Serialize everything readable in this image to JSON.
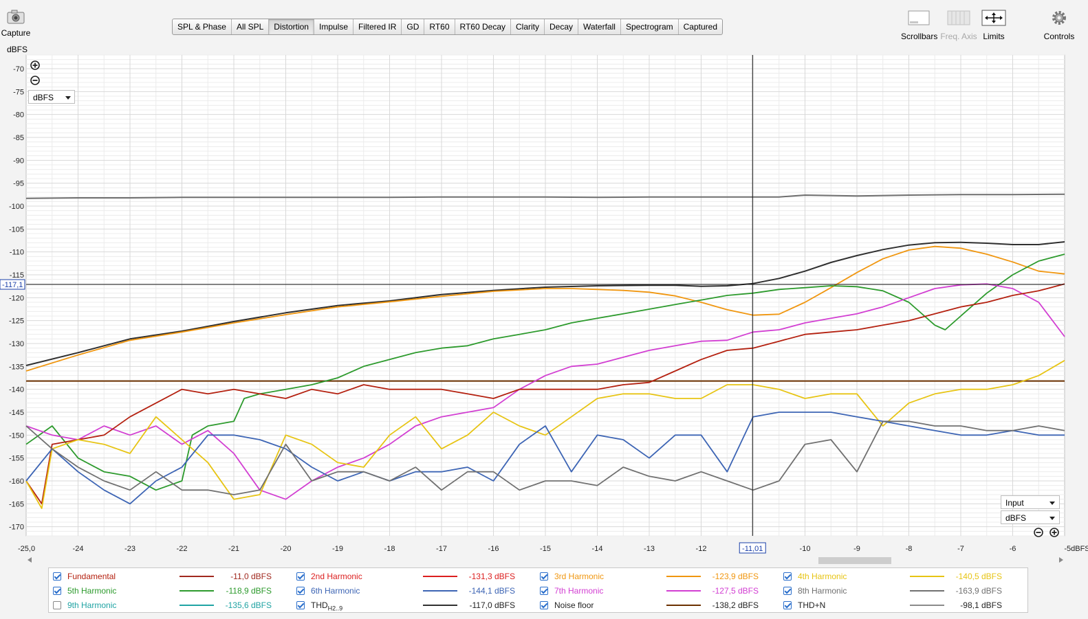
{
  "toolbar": {
    "capture_label": "Capture",
    "tabs": [
      "SPL & Phase",
      "All SPL",
      "Distortion",
      "Impulse",
      "Filtered IR",
      "GD",
      "RT60",
      "RT60 Decay",
      "Clarity",
      "Decay",
      "Waterfall",
      "Spectrogram",
      "Captured"
    ],
    "active_tab": "Distortion",
    "scrollbars_label": "Scrollbars",
    "freq_axis_label": "Freq. Axis",
    "limits_label": "Limits",
    "controls_label": "Controls"
  },
  "y_unit_label": "dBFS",
  "unit_dropdown": "dBFS",
  "input_dropdown": "Input",
  "scale_dropdown": "dBFS",
  "cursor": {
    "x": -11.01,
    "y": -117.1,
    "x_label": "-11,01",
    "y_label": "-117,1"
  },
  "chart_data": {
    "type": "line",
    "xlim": [
      -25,
      -5
    ],
    "ylim": [
      -172,
      -67
    ],
    "x_ticks": [
      -24,
      -23,
      -22,
      -21,
      -20,
      -19,
      -18,
      -17,
      -16,
      -15,
      -14,
      -13,
      -12,
      -11,
      -10,
      -9,
      -8,
      -7,
      -6
    ],
    "x_tick_labels": [
      "-24",
      "-23",
      "-22",
      "-21",
      "-20",
      "-19",
      "-18",
      "-17",
      "-16",
      "-15",
      "-14",
      "-13",
      "-12",
      "-11",
      "-10",
      "-9",
      "-8",
      "-7",
      "-6"
    ],
    "x_min_label": "-25,0",
    "x_max_label": "-5dBFS",
    "y_ticks": [
      -70,
      -75,
      -80,
      -85,
      -90,
      -95,
      -100,
      -105,
      -110,
      -115,
      -120,
      -125,
      -130,
      -135,
      -140,
      -145,
      -150,
      -155,
      -160,
      -165,
      -170
    ],
    "y_tick_labels": [
      "-70",
      "-75",
      "-80",
      "-85",
      "-90",
      "-95",
      "-100",
      "-105",
      "-110",
      "-115",
      "-120",
      "-125",
      "-130",
      "-135",
      "-140",
      "-145",
      "-150",
      "-155",
      "-160",
      "-165",
      "-170"
    ],
    "grid": true,
    "series": [
      {
        "name": "THD+N",
        "color": "#6e6e6e",
        "x": [
          -25,
          -24,
          -23,
          -22,
          -21,
          -20,
          -19,
          -18,
          -17,
          -16,
          -15,
          -14,
          -13,
          -12,
          -11,
          -10.5,
          -10,
          -9,
          -8,
          -7,
          -6,
          -5
        ],
        "y": [
          -98.3,
          -98.2,
          -98.2,
          -98.1,
          -98.1,
          -98.1,
          -98.1,
          -98.1,
          -98.0,
          -98.0,
          -98.0,
          -98.1,
          -98.0,
          -98.0,
          -98.0,
          -98.0,
          -97.6,
          -97.8,
          -97.6,
          -97.5,
          -97.5,
          -97.4
        ]
      },
      {
        "name": "THD<sub>H2..9</sub>",
        "color": "#2f2f2f",
        "x": [
          -25,
          -24,
          -23,
          -22,
          -21,
          -20,
          -19,
          -18,
          -17,
          -16,
          -15,
          -14,
          -13,
          -12.5,
          -12,
          -11.5,
          -11,
          -10.5,
          -10,
          -9.5,
          -9,
          -8.5,
          -8,
          -7.5,
          -7,
          -6.5,
          -6,
          -5.5,
          -5
        ],
        "y": [
          -134.8,
          -132.0,
          -129.0,
          -127.3,
          -125.2,
          -123.3,
          -121.7,
          -120.7,
          -119.3,
          -118.4,
          -117.7,
          -117.4,
          -117.3,
          -117.3,
          -117.5,
          -117.4,
          -116.9,
          -115.8,
          -114.2,
          -112.3,
          -110.8,
          -109.5,
          -108.5,
          -108.0,
          -107.9,
          -108.1,
          -108.4,
          -108.4,
          -107.8
        ]
      },
      {
        "name": "3rd Harmonic",
        "color": "#f0960f",
        "x": [
          -25,
          -24,
          -23,
          -22,
          -21,
          -20,
          -19,
          -18,
          -17,
          -16,
          -15,
          -14.5,
          -14,
          -13.5,
          -13,
          -12.5,
          -12,
          -11.5,
          -11,
          -10.5,
          -10,
          -9.5,
          -9,
          -8.5,
          -8,
          -7.5,
          -7,
          -6.5,
          -6,
          -5.5,
          -5
        ],
        "y": [
          -136.0,
          -132.5,
          -129.3,
          -127.5,
          -125.5,
          -123.7,
          -122.0,
          -120.9,
          -119.7,
          -118.6,
          -118.0,
          -118.0,
          -118.2,
          -118.4,
          -118.8,
          -119.6,
          -121.0,
          -122.6,
          -123.8,
          -123.6,
          -121.0,
          -117.8,
          -114.5,
          -111.5,
          -109.6,
          -108.8,
          -109.2,
          -110.5,
          -112.2,
          -114.2,
          -114.8
        ]
      },
      {
        "name": "5th Harmonic",
        "color": "#2c9a2c",
        "x": [
          -25,
          -24.5,
          -24,
          -23.5,
          -23,
          -22.5,
          -22,
          -21.8,
          -21.5,
          -21,
          -20.8,
          -20.5,
          -20,
          -19.5,
          -19,
          -18.5,
          -18,
          -17.5,
          -17,
          -16.5,
          -16,
          -15.5,
          -15,
          -14.5,
          -14,
          -13.5,
          -13,
          -12.5,
          -12,
          -11.5,
          -11,
          -10.5,
          -10,
          -9.5,
          -9,
          -8.5,
          -8,
          -7.5,
          -7.3,
          -7,
          -6.5,
          -6,
          -5.5,
          -5
        ],
        "y": [
          -152,
          -148,
          -155,
          -158,
          -159,
          -162,
          -160,
          -150,
          -148,
          -147,
          -142,
          -141,
          -140,
          -139,
          -137.5,
          -135,
          -133.5,
          -132,
          -131,
          -130.5,
          -129,
          -128,
          -127,
          -125.5,
          -124.5,
          -123.5,
          -122.5,
          -121.5,
          -120.5,
          -119.5,
          -119,
          -118.2,
          -117.8,
          -117.4,
          -117.6,
          -118.5,
          -121,
          -126,
          -127,
          -124,
          -119,
          -115,
          -112,
          -110.5
        ]
      },
      {
        "name": "7th Harmonic",
        "color": "#d23ed2",
        "x": [
          -25,
          -24.5,
          -24,
          -23.5,
          -23,
          -22.5,
          -22,
          -21.5,
          -21,
          -20.5,
          -20,
          -19.5,
          -19,
          -18.5,
          -18,
          -17.5,
          -17,
          -16.5,
          -16,
          -15.5,
          -15,
          -14.5,
          -14,
          -13.5,
          -13,
          -12.5,
          -12,
          -11.5,
          -11,
          -10.5,
          -10,
          -9.5,
          -9,
          -8.5,
          -8,
          -7.5,
          -7,
          -6.5,
          -6,
          -5.5,
          -5
        ],
        "y": [
          -148,
          -150,
          -151,
          -148,
          -150,
          -148,
          -152,
          -149,
          -154,
          -162,
          -164,
          -160,
          -157,
          -155,
          -152,
          -148,
          -146,
          -145,
          -144,
          -140,
          -137,
          -135,
          -134.5,
          -133,
          -131.5,
          -130.5,
          -129.5,
          -129.3,
          -127.5,
          -127,
          -125.5,
          -124.5,
          -123.5,
          -122,
          -120,
          -118,
          -117.2,
          -117,
          -118,
          -121,
          -128.5
        ]
      },
      {
        "name": "Fundamental",
        "color": "#b4200f",
        "x": [
          -25,
          -24.7,
          -24.5,
          -24,
          -23.5,
          -23,
          -22.5,
          -22,
          -21.5,
          -21,
          -20.5,
          -20,
          -19.5,
          -19,
          -18.5,
          -18,
          -17.5,
          -17,
          -16.5,
          -16,
          -15.5,
          -15,
          -14.5,
          -14,
          -13.5,
          -13,
          -12.5,
          -12,
          -11.5,
          -11,
          -10.5,
          -10,
          -9.5,
          -9,
          -8.5,
          -8,
          -7.5,
          -7,
          -6.5,
          -6,
          -5.5,
          -5
        ],
        "y": [
          -160,
          -165,
          -152,
          -151,
          -150,
          -146,
          -143,
          -140,
          -141,
          -140,
          -141,
          -142,
          -140,
          -141,
          -139,
          -140,
          -140,
          -140,
          -141,
          -142,
          -140,
          -140,
          -140,
          -140,
          -139,
          -138.5,
          -136,
          -133.5,
          -131.5,
          -131,
          -129.5,
          -128,
          -127.5,
          -127,
          -126,
          -125,
          -123.5,
          -122,
          -121,
          -119.5,
          -118.5,
          -117
        ]
      },
      {
        "name": "4th Harmonic",
        "color": "#e7c413",
        "x": [
          -25,
          -24.7,
          -24.5,
          -24,
          -23.5,
          -23,
          -22.5,
          -22,
          -21.5,
          -21,
          -20.5,
          -20,
          -19.5,
          -19,
          -18.5,
          -18,
          -17.5,
          -17,
          -16.5,
          -16,
          -15.5,
          -15,
          -14.5,
          -14,
          -13.5,
          -13,
          -12.5,
          -12,
          -11.5,
          -11,
          -10.5,
          -10,
          -9.5,
          -9,
          -8.5,
          -8,
          -7.5,
          -7,
          -6.5,
          -6,
          -5.5,
          -5
        ],
        "y": [
          -160,
          -166,
          -153,
          -151,
          -152,
          -154,
          -146,
          -151,
          -156,
          -164,
          -163,
          -150,
          -152,
          -156,
          -157,
          -150,
          -146,
          -153,
          -150,
          -145,
          -148,
          -150,
          -146,
          -142,
          -141,
          -141,
          -142,
          -142,
          -139,
          -139,
          -140,
          -142,
          -141,
          -141,
          -148,
          -143,
          -141,
          -140,
          -140,
          -139,
          -137,
          -133.7
        ]
      },
      {
        "name": "6th Harmonic",
        "color": "#3c64b4",
        "x": [
          -25,
          -24.5,
          -24,
          -23.5,
          -23,
          -22.5,
          -22,
          -21.5,
          -21,
          -20.5,
          -20,
          -19.5,
          -19,
          -18.5,
          -18,
          -17.5,
          -17,
          -16.5,
          -16,
          -15.5,
          -15,
          -14.5,
          -14,
          -13.5,
          -13,
          -12.5,
          -12,
          -11.5,
          -11,
          -10.5,
          -10,
          -9.5,
          -9,
          -8.5,
          -8,
          -7.5,
          -7,
          -6.5,
          -6,
          -5.5,
          -5
        ],
        "y": [
          -160,
          -153,
          -158,
          -162,
          -165,
          -160,
          -157,
          -150,
          -150,
          -151,
          -153,
          -157,
          -160,
          -158,
          -160,
          -158,
          -158,
          -157,
          -160,
          -152,
          -148,
          -158,
          -150,
          -151,
          -155,
          -150,
          -150,
          -158,
          -146,
          -145,
          -145,
          -145,
          -146,
          -147,
          -148,
          -149,
          -150,
          -150,
          -149,
          -150,
          -150
        ]
      },
      {
        "name": "8th Harmonic",
        "color": "#707070",
        "x": [
          -25,
          -24.5,
          -24,
          -23.5,
          -23,
          -22.5,
          -22,
          -21.5,
          -21,
          -20.5,
          -20,
          -19.5,
          -19,
          -18.5,
          -18,
          -17.5,
          -17,
          -16.5,
          -16,
          -15.5,
          -15,
          -14.5,
          -14,
          -13.5,
          -13,
          -12.5,
          -12,
          -11.5,
          -11,
          -10.5,
          -10,
          -9.5,
          -9,
          -8.5,
          -8,
          -7.5,
          -7,
          -6.5,
          -6,
          -5.5,
          -5
        ],
        "y": [
          -148,
          -153,
          -157,
          -160,
          -162,
          -158,
          -162,
          -162,
          -163,
          -162,
          -152,
          -160,
          -158,
          -158,
          -160,
          -157,
          -162,
          -158,
          -158,
          -162,
          -160,
          -160,
          -161,
          -157,
          -159,
          -160,
          -158,
          -160,
          -162,
          -160,
          -152,
          -151,
          -158,
          -147,
          -147,
          -148,
          -148,
          -149,
          -149,
          -148,
          -149
        ]
      }
    ]
  },
  "legend": [
    {
      "name": "Fundamental",
      "checked": true,
      "color": "#a0281e",
      "value": "-11,0 dBFS"
    },
    {
      "name": "2nd Harmonic",
      "checked": true,
      "color": "#dc1e1e",
      "value": "-131,3 dBFS"
    },
    {
      "name": "3rd Harmonic",
      "checked": true,
      "color": "#f0960f",
      "value": "-123,9 dBFS"
    },
    {
      "name": "4th Harmonic",
      "checked": true,
      "color": "#e7c413",
      "value": "-140,5 dBFS"
    },
    {
      "name": "5th Harmonic",
      "checked": true,
      "color": "#2c9a2c",
      "value": "-118,9 dBFS"
    },
    {
      "name": "6th Harmonic",
      "checked": true,
      "color": "#3c64b4",
      "value": "-144,1 dBFS"
    },
    {
      "name": "7th Harmonic",
      "checked": true,
      "color": "#d23ed2",
      "value": "-127,5 dBFS"
    },
    {
      "name": "8th Harmonic",
      "checked": true,
      "color": "#707070",
      "value": "-163,9 dBFS"
    },
    {
      "name": "9th Harmonic",
      "checked": false,
      "color": "#1fa3a3",
      "value": "-135,6 dBFS"
    },
    {
      "name": "THD",
      "sub": "H2..9",
      "checked": true,
      "color": "#2f2f2f",
      "value": "-117,0 dBFS"
    },
    {
      "name": "Noise floor",
      "checked": true,
      "color": "#6b3000",
      "value": "-138,2 dBFS"
    },
    {
      "name": "THD+N",
      "checked": true,
      "color": "#8a8a8a",
      "value": "-98,1 dBFS"
    }
  ],
  "noise_floor_level": -138.2,
  "colors": {
    "grid": "#d8d8d8",
    "minor_grid": "#ececec",
    "cursor_label": "#1a3fa8"
  }
}
